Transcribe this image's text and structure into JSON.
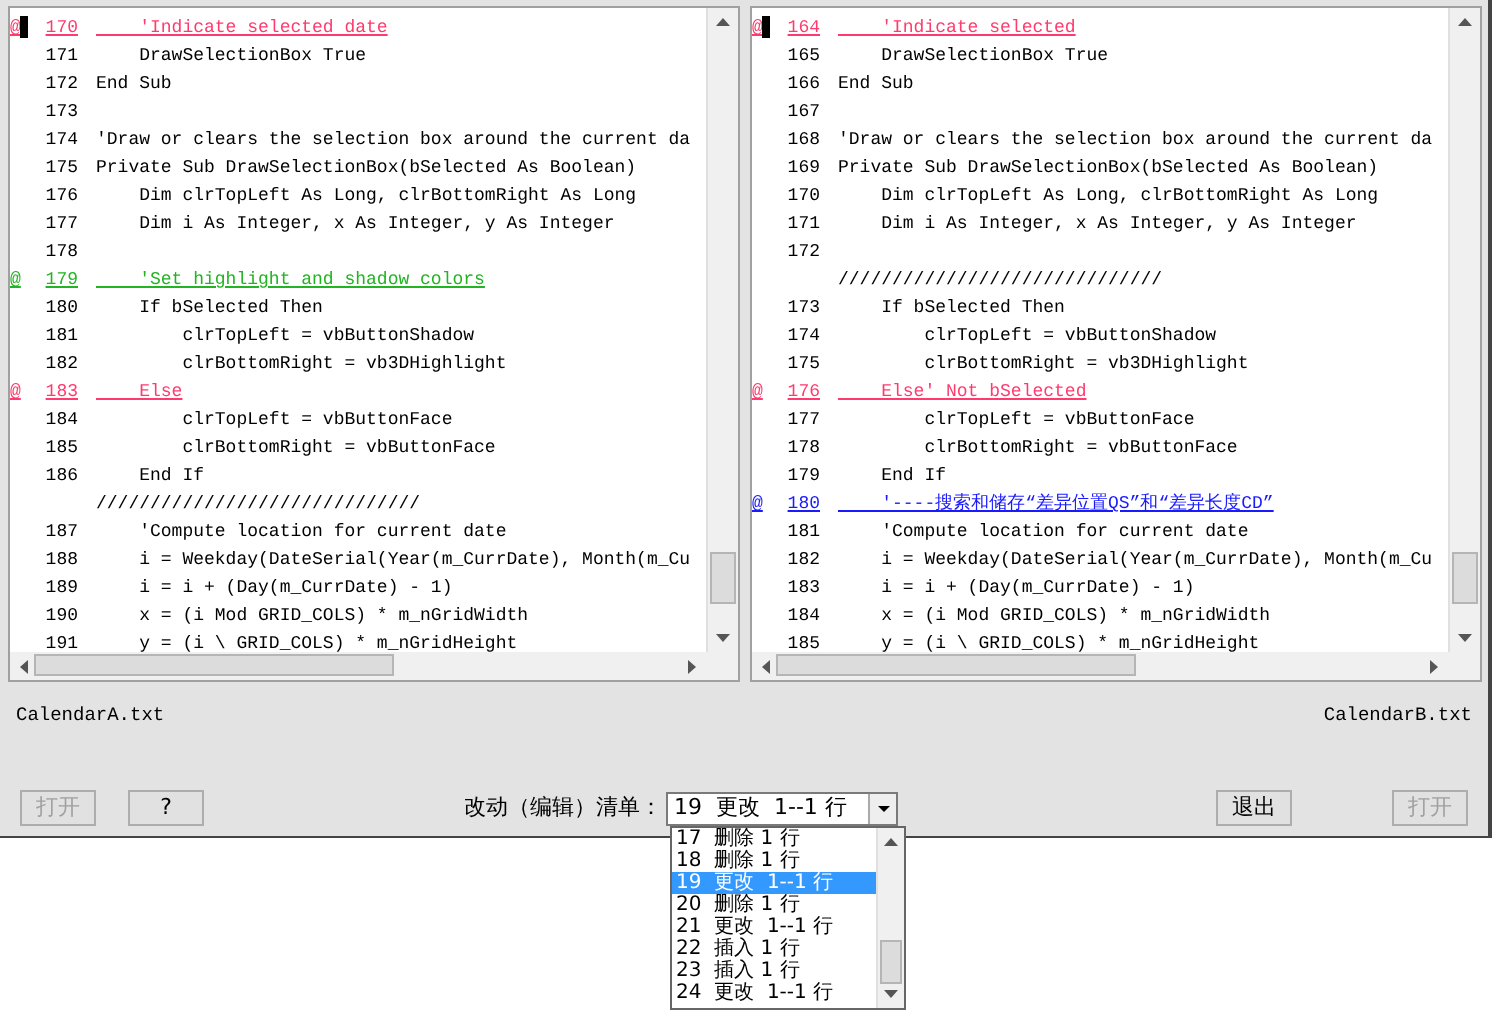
{
  "panes": [
    {
      "file_name": "CalendarA.txt",
      "lines": [
        {
          "marker": "@",
          "number": "170",
          "text": "    'Indicate selected date",
          "color": "#ff3a6e",
          "cursor": true
        },
        {
          "number": "171",
          "text": "    DrawSelectionBox True",
          "cursor": false
        },
        {
          "number": "172",
          "text": "End Sub",
          "cursor": false
        },
        {
          "number": "173",
          "cursor": false
        },
        {
          "number": "174",
          "text": "'Draw or clears the selection box around the current da",
          "cursor": false
        },
        {
          "number": "175",
          "text": "Private Sub DrawSelectionBox(bSelected As Boolean)",
          "cursor": false
        },
        {
          "number": "176",
          "text": "    Dim clrTopLeft As Long, clrBottomRight As Long",
          "cursor": false
        },
        {
          "number": "177",
          "text": "    Dim i As Integer, x As Integer, y As Integer",
          "cursor": false
        },
        {
          "number": "178",
          "cursor": false
        },
        {
          "marker": "@",
          "number": "179",
          "text": "    'Set highlight and shadow colors",
          "color": "#22b422",
          "cursor": false
        },
        {
          "number": "180",
          "text": "    If bSelected Then",
          "cursor": false
        },
        {
          "number": "181",
          "text": "        clrTopLeft = vbButtonShadow",
          "cursor": false
        },
        {
          "number": "182",
          "text": "        clrBottomRight = vb3DHighlight",
          "cursor": false
        },
        {
          "marker": "@",
          "number": "183",
          "text": "    Else",
          "color": "#ff3a6e",
          "cursor": false
        },
        {
          "number": "184",
          "text": "        clrTopLeft = vbButtonFace",
          "cursor": false
        },
        {
          "number": "185",
          "text": "        clrBottomRight = vbButtonFace",
          "cursor": false
        },
        {
          "number": "186",
          "text": "    End If",
          "cursor": false
        },
        {
          "text": "//////////////////////////////",
          "cursor": false
        },
        {
          "number": "187",
          "text": "    'Compute location for current date",
          "cursor": false
        },
        {
          "number": "188",
          "text": "    i = Weekday(DateSerial(Year(m_CurrDate), Month(m_Cu",
          "cursor": false
        },
        {
          "number": "189",
          "text": "    i = i + (Day(m_CurrDate) - 1)",
          "cursor": false
        },
        {
          "number": "190",
          "text": "    x = (i Mod GRID_COLS) * m_nGridWidth",
          "cursor": false
        },
        {
          "number": "191",
          "text": "    y = (i \\ GRID_COLS) * m_nGridHeight",
          "cursor": false
        }
      ]
    },
    {
      "file_name": "CalendarB.txt",
      "lines": [
        {
          "marker": "@",
          "number": "164",
          "text": "    'Indicate selected",
          "color": "#ff3a6e",
          "cursor": true
        },
        {
          "number": "165",
          "text": "    DrawSelectionBox True",
          "cursor": false
        },
        {
          "number": "166",
          "text": "End Sub",
          "cursor": false
        },
        {
          "number": "167",
          "cursor": false
        },
        {
          "number": "168",
          "text": "'Draw or clears the selection box around the current da",
          "cursor": false
        },
        {
          "number": "169",
          "text": "Private Sub DrawSelectionBox(bSelected As Boolean)",
          "cursor": false
        },
        {
          "number": "170",
          "text": "    Dim clrTopLeft As Long, clrBottomRight As Long",
          "cursor": false
        },
        {
          "number": "171",
          "text": "    Dim i As Integer, x As Integer, y As Integer",
          "cursor": false
        },
        {
          "number": "172",
          "cursor": false
        },
        {
          "text": "//////////////////////////////",
          "cursor": false
        },
        {
          "number": "173",
          "text": "    If bSelected Then",
          "cursor": false
        },
        {
          "number": "174",
          "text": "        clrTopLeft = vbButtonShadow",
          "cursor": false
        },
        {
          "number": "175",
          "text": "        clrBottomRight = vb3DHighlight",
          "cursor": false
        },
        {
          "marker": "@",
          "number": "176",
          "text": "    Else' Not bSelected",
          "color": "#ff3a6e",
          "cursor": false
        },
        {
          "number": "177",
          "text": "        clrTopLeft = vbButtonFace",
          "cursor": false
        },
        {
          "number": "178",
          "text": "        clrBottomRight = vbButtonFace",
          "cursor": false
        },
        {
          "number": "179",
          "text": "    End If",
          "cursor": false
        },
        {
          "marker": "@",
          "number": "180",
          "text": "    '----搜索和储存“差异位置QS”和“差异长度CD”",
          "color": "#1a1aff",
          "cursor": false
        },
        {
          "number": "181",
          "text": "    'Compute location for current date",
          "cursor": false
        },
        {
          "number": "182",
          "text": "    i = Weekday(DateSerial(Year(m_CurrDate), Month(m_Cu",
          "cursor": false
        },
        {
          "number": "183",
          "text": "    i = i + (Day(m_CurrDate) - 1)",
          "cursor": false
        },
        {
          "number": "184",
          "text": "    x = (i Mod GRID_COLS) * m_nGridWidth",
          "cursor": false
        },
        {
          "number": "185",
          "text": "    y = (i \\ GRID_COLS) * m_nGridHeight",
          "cursor": false
        }
      ]
    }
  ],
  "left_buttons": [
    {
      "label": "打开",
      "disabled": true
    },
    {
      "label": "?",
      "disabled": false
    }
  ],
  "change_list": {
    "label": "改动（编辑）清单：",
    "value": "19  更改  1--1 行",
    "options": [
      {
        "text": "17  删除 1 行",
        "selected": false
      },
      {
        "text": "18  删除 1 行",
        "selected": false
      },
      {
        "text": "19  更改  1--1 行",
        "selected": true
      },
      {
        "text": "20  删除 1 行",
        "selected": false
      },
      {
        "text": "21  更改  1--1 行",
        "selected": false
      },
      {
        "text": "22  插入 1 行",
        "selected": false
      },
      {
        "text": "23  插入 1 行",
        "selected": false
      },
      {
        "text": "24  更改  1--1 行",
        "selected": false
      }
    ]
  },
  "right_buttons": [
    {
      "label": "退出",
      "disabled": false
    },
    {
      "label": "打开",
      "disabled": true
    }
  ]
}
